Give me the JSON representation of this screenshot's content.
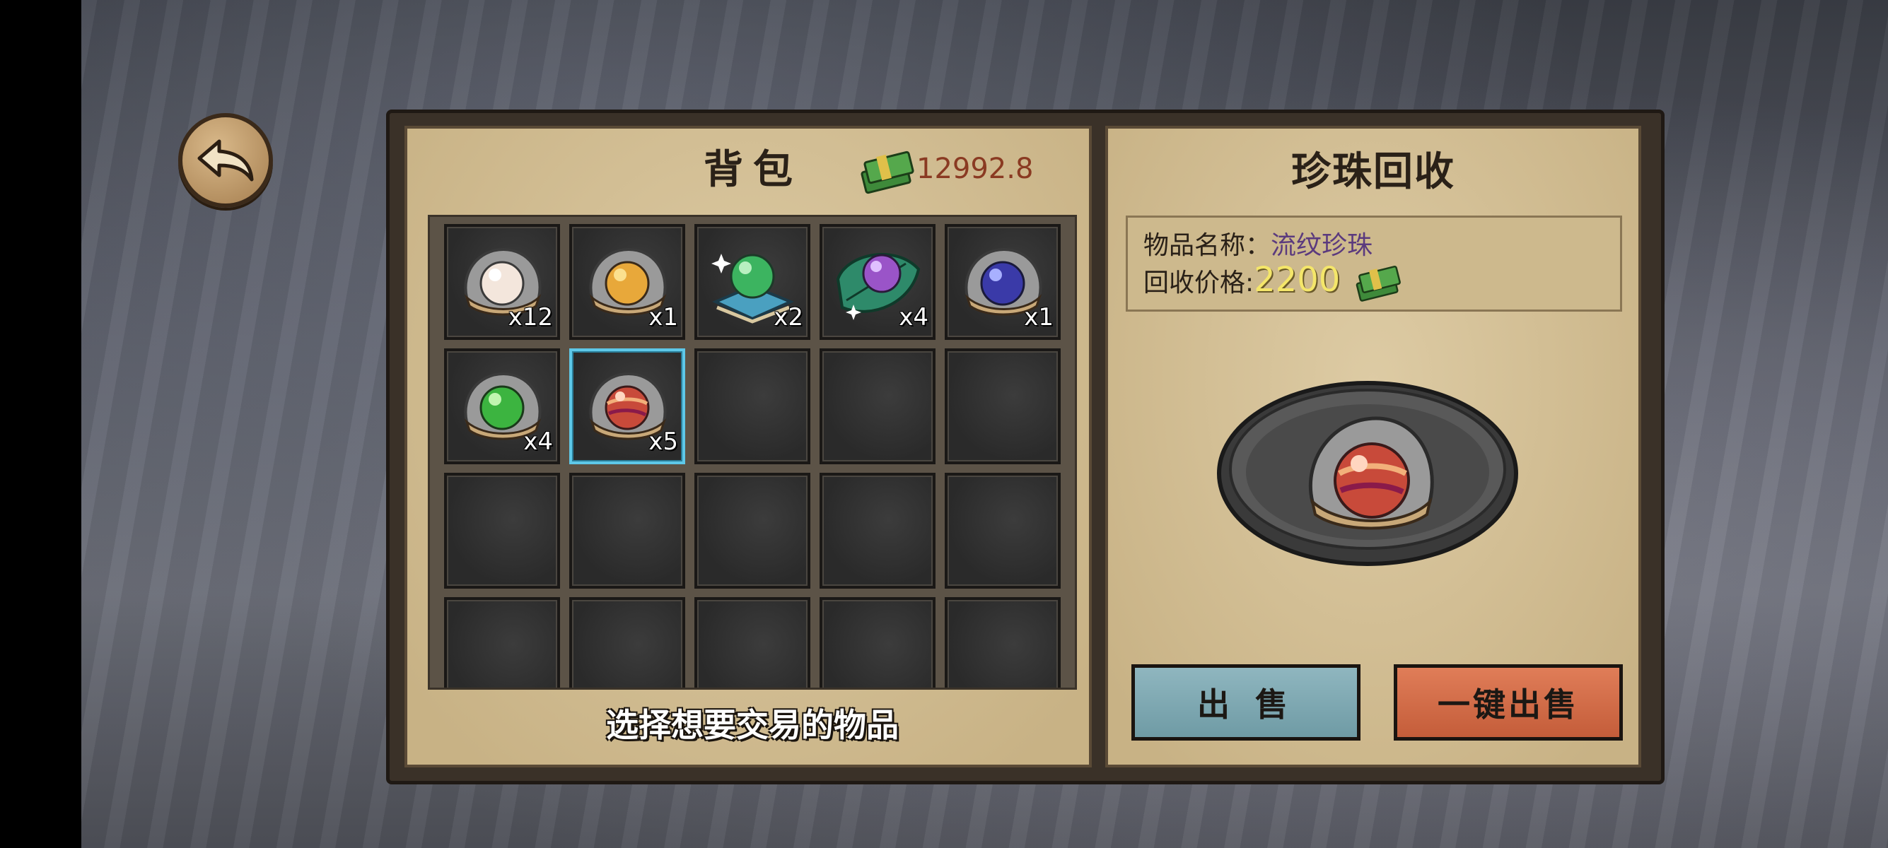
{
  "backpack": {
    "title": "背包",
    "money": "12992.8",
    "hint": "选择想要交易的物品",
    "slots": [
      {
        "item": "white-pearl",
        "count": "x12",
        "selected": false
      },
      {
        "item": "gold-pearl",
        "count": "x1",
        "selected": false
      },
      {
        "item": "green-orb-stand",
        "count": "x2",
        "selected": false
      },
      {
        "item": "purple-orb-leaf",
        "count": "x4",
        "selected": false
      },
      {
        "item": "blue-pearl",
        "count": "x1",
        "selected": false
      },
      {
        "item": "green-pearl",
        "count": "x4",
        "selected": false
      },
      {
        "item": "striped-pearl",
        "count": "x5",
        "selected": true
      }
    ]
  },
  "recycle": {
    "title": "珍珠回收",
    "name_label": "物品名称：",
    "name_value": "流纹珍珠",
    "price_label": "回收价格:",
    "price_value": "2200",
    "sell_button": "出 售",
    "sell_all_button": "一键出售"
  },
  "colors": {
    "accent_selected": "#5ec8e8",
    "sell_button": "#7fa8b1",
    "sell_all_button": "#d06b47",
    "money_text": "#8a3a22",
    "price_text": "#f4e66a"
  }
}
